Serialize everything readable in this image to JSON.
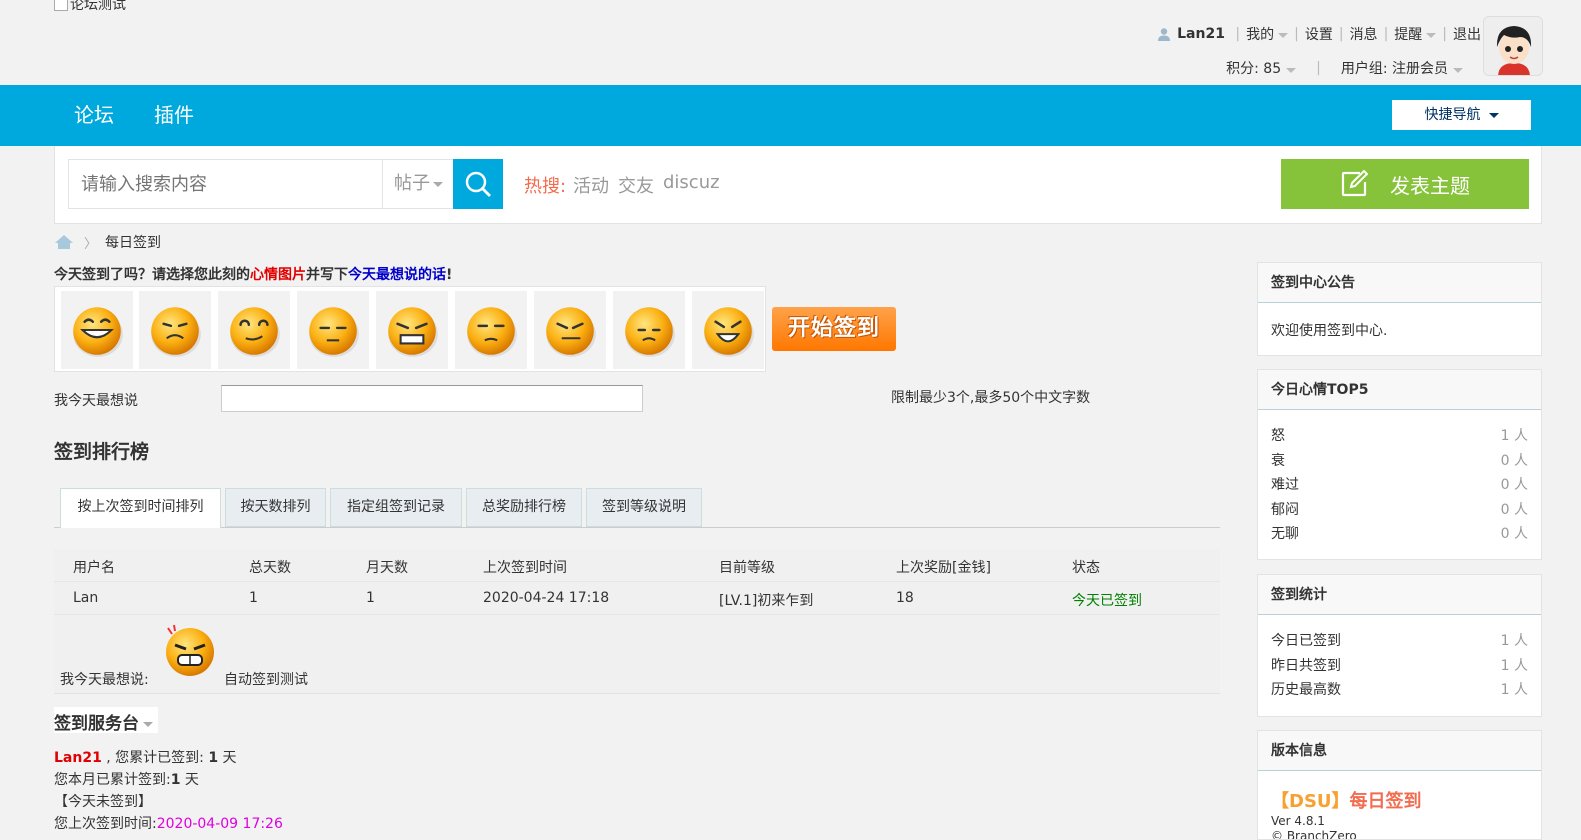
{
  "header": {
    "logo_alt": "论坛测试",
    "username": "Lan21",
    "links": [
      "我的",
      "设置",
      "消息",
      "提醒",
      "退出"
    ],
    "points": "积分: 85",
    "user_group": "用户组: 注册会员"
  },
  "nav": {
    "items": [
      "论坛",
      "插件"
    ],
    "quick_nav": "快捷导航"
  },
  "search": {
    "placeholder": "请输入搜索内容",
    "type": "帖子",
    "hot_label": "热搜:",
    "hot_words": [
      "活动",
      "交友",
      "discuz"
    ],
    "post_button": "发表主题"
  },
  "breadcrumb": {
    "current": "每日签到"
  },
  "sign": {
    "prompt_a": "今天签到了吗？请选择您此刻的",
    "prompt_red": "心情图片",
    "prompt_b": "并写下",
    "prompt_blue": "今天最想说的话",
    "prompt_c": "!",
    "emotions": [
      "开心",
      "难过",
      "郁闷",
      "无聊",
      "怒",
      "擦汗",
      "奋斗",
      "慵懒",
      "衰"
    ],
    "start_button": "开始签到",
    "say_label": "我今天最想说",
    "say_value": "",
    "limit_text": "限制最少3个,最多50个中文字数"
  },
  "ranking": {
    "title": "签到排行榜",
    "tabs": [
      "按上次签到时间排列",
      "按天数排列",
      "指定组签到记录",
      "总奖励排行榜",
      "签到等级说明"
    ],
    "columns": [
      "用户名",
      "总天数",
      "月天数",
      "上次签到时间",
      "目前等级",
      "上次奖励[金钱]",
      "状态"
    ],
    "rows": [
      {
        "user": "Lan",
        "total": "1",
        "month": "1",
        "last_time": "2020-04-24 17:18",
        "level": "[LV.1]初来乍到",
        "reward": "18",
        "status": "今天已签到"
      }
    ],
    "say_label": "我今天最想说:",
    "say_text": "自动签到测试"
  },
  "service": {
    "title": "签到服务台",
    "user": "Lan21",
    "line1": " , 您累计已签到: ",
    "line1_days": "1",
    "line1_unit": " 天",
    "line2": "您本月已累计签到:",
    "line2_days": "1",
    "line2_unit": " 天",
    "line3": "【今天未签到】",
    "line4": "您上次签到时间:",
    "line4_time": "2020-04-09 17:26"
  },
  "sidebar": {
    "notice_title": "签到中心公告",
    "notice_text": "欢迎使用签到中心.",
    "mood_title": "今日心情TOP5",
    "moods": [
      {
        "name": "怒",
        "count": "1 人"
      },
      {
        "name": "衰",
        "count": "0 人"
      },
      {
        "name": "难过",
        "count": "0 人"
      },
      {
        "name": "郁闷",
        "count": "0 人"
      },
      {
        "name": "无聊",
        "count": "0 人"
      }
    ],
    "stats_title": "签到统计",
    "stats": [
      {
        "name": "今日已签到",
        "count": "1 人"
      },
      {
        "name": "昨日共签到",
        "count": "1 人"
      },
      {
        "name": "历史最高数",
        "count": "1 人"
      }
    ],
    "version_title": "版本信息",
    "version_brand": "【DSU】",
    "version_name": "每日签到",
    "version": "Ver 4.8.1",
    "copyright": "© BranchZero"
  },
  "colors": {
    "nav_blue": "#00a9dd",
    "post_green": "#86c33a",
    "hot_orange": "#f26c4f",
    "sign_orange": "#ff7700"
  }
}
